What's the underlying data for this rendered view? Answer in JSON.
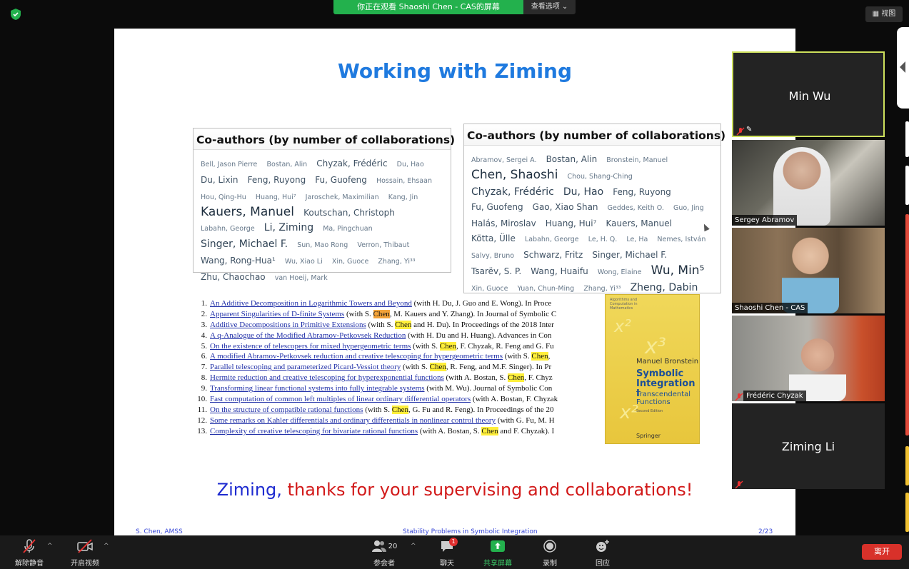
{
  "top_bar": {
    "share_banner": "你正在观看 Shaoshi Chen - CAS的屏幕",
    "view_options": "查看选项",
    "view_button": "视图",
    "accent_green": "#23b14d"
  },
  "slide": {
    "title": "Working with Ziming",
    "coauthors_left": {
      "header": "Co-authors (by number of collaborations)",
      "names": [
        {
          "t": "Bell, Jason Pierre",
          "w": 1
        },
        {
          "t": "Bostan, Alin",
          "w": 1
        },
        {
          "t": "Chyzak, Frédéric",
          "w": 2
        },
        {
          "t": "Du, Hao",
          "w": 1
        },
        {
          "t": "Du, Lixin",
          "w": 2
        },
        {
          "t": "Feng, Ruyong",
          "w": 2
        },
        {
          "t": "Fu, Guofeng",
          "w": 2
        },
        {
          "t": "Hossain, Ehsaan",
          "w": 1
        },
        {
          "t": "Hou, Qing-Hu",
          "w": 1
        },
        {
          "t": "Huang, Hui⁷",
          "w": 1
        },
        {
          "t": "Jaroschek, Maximilian",
          "w": 1
        },
        {
          "t": "Kang, Jin",
          "w": 1
        },
        {
          "t": "Kauers, Manuel",
          "w": 4
        },
        {
          "t": "Koutschan, Christoph",
          "w": 2
        },
        {
          "t": "Labahn, George",
          "w": 1
        },
        {
          "t": "Li, Ziming",
          "w": 3
        },
        {
          "t": "Ma, Pingchuan",
          "w": 1
        },
        {
          "t": "Singer, Michael F.",
          "w": 3
        },
        {
          "t": "Sun, Mao Rong",
          "w": 1
        },
        {
          "t": "Verron, Thibaut",
          "w": 1
        },
        {
          "t": "Wang, Rong-Hua¹",
          "w": 2
        },
        {
          "t": "Wu, Xiao Li",
          "w": 1
        },
        {
          "t": "Xin, Guoce",
          "w": 1
        },
        {
          "t": "Zhang, Yi³³",
          "w": 1
        },
        {
          "t": "Zhu, Chaochao",
          "w": 2
        },
        {
          "t": "van Hoeij, Mark",
          "w": 1
        }
      ]
    },
    "coauthors_right": {
      "header": "Co-authors (by number of collaborations)",
      "names": [
        {
          "t": "Abramov, Sergei A.",
          "w": 1
        },
        {
          "t": "Bostan, Alin",
          "w": 2
        },
        {
          "t": "Bronstein, Manuel",
          "w": 1
        },
        {
          "t": "Chen, Shaoshi",
          "w": 4
        },
        {
          "t": "Chou, Shang-Ching",
          "w": 1
        },
        {
          "t": "Chyzak, Frédéric",
          "w": 3
        },
        {
          "t": "Du, Hao",
          "w": 3
        },
        {
          "t": "Feng, Ruyong",
          "w": 2
        },
        {
          "t": "Fu, Guofeng",
          "w": 2
        },
        {
          "t": "Gao, Xiao Shan",
          "w": 2
        },
        {
          "t": "Geddes, Keith O.",
          "w": 1
        },
        {
          "t": "Guo, Jing",
          "w": 1
        },
        {
          "t": "Halás, Miroslav",
          "w": 2
        },
        {
          "t": "Huang, Hui⁷",
          "w": 2
        },
        {
          "t": "Kauers, Manuel",
          "w": 2
        },
        {
          "t": "Kötta, Ülle",
          "w": 2
        },
        {
          "t": "Labahn, George",
          "w": 1
        },
        {
          "t": "Le, H. Q.",
          "w": 1
        },
        {
          "t": "Le, Ha",
          "w": 1
        },
        {
          "t": "Nemes, István",
          "w": 1
        },
        {
          "t": "Salvy, Bruno",
          "w": 1
        },
        {
          "t": "Schwarz, Fritz",
          "w": 2
        },
        {
          "t": "Singer, Michael F.",
          "w": 2
        },
        {
          "t": "Tsarëv, S. P.",
          "w": 2
        },
        {
          "t": "Wang, Huaifu",
          "w": 2
        },
        {
          "t": "Wong, Elaine",
          "w": 1
        },
        {
          "t": "Wu, Min⁵",
          "w": 4
        },
        {
          "t": "Xin, Guoce",
          "w": 1
        },
        {
          "t": "Yuan, Chun-Ming",
          "w": 1
        },
        {
          "t": "Zhang, Yi³³",
          "w": 1
        },
        {
          "t": "Zheng, Dabin",
          "w": 3
        }
      ]
    },
    "papers": [
      {
        "n": "1.",
        "title": "An Additive Decomposition in Logarithmic Towers and Beyond",
        "rest": " (with H. Du, J. Guo and E. Wong). In Proce"
      },
      {
        "n": "2.",
        "title": "Apparent Singularities of D-finite Systems",
        "pre": " (with S. ",
        "hl": "Chen",
        "post": ", M. Kauers and Y. Zhang). In Journal of Symbolic C",
        "orange": true
      },
      {
        "n": "3.",
        "title": "Additive Decompositions in Primitive Extensions",
        "pre": " (with S. ",
        "hl": "Chen",
        "post": " and H. Du). In Proceedings of the 2018 Inter"
      },
      {
        "n": "4.",
        "title": "A q-Analogue of the Modified Abramov-Petkovsek Reduction",
        "rest": " (with H. Du and H. Huang). Advances in Con"
      },
      {
        "n": "5.",
        "title": "On the existence of telescopers for mixed hypergeometric terms",
        "pre": " (with S. ",
        "hl": "Chen",
        "post": ", F. Chyzak, R. Feng and G. Fu"
      },
      {
        "n": "6.",
        "title": "A modified Abramov-Petkovsek reduction and creative telescoping for hypergeometric terms",
        "pre": " (with S. ",
        "hl": "Chen",
        "post": ", "
      },
      {
        "n": "7.",
        "title": "Parallel telescoping and parameterized Picard-Vessiot theory",
        "pre": " (with S. ",
        "hl": "Chen",
        "post": ", R. Feng, and M.F. Singer). In Pr"
      },
      {
        "n": "8.",
        "title": "Hermite reduction and creative telescoping for hyperexponential functions",
        "pre": " (with A. Bostan, S. ",
        "hl": "Chen",
        "post": ", F. Chyz"
      },
      {
        "n": "9.",
        "title": "Transforming linear functional systems into fully integrable systems",
        "rest": " (with M. Wu). Journal of Symbolic Con"
      },
      {
        "n": "10.",
        "title": "Fast computation of common left multiples of linear ordinary differential operators",
        "rest": " (with A. Bostan, F. Chyzak"
      },
      {
        "n": "11.",
        "title": "On the structure of compatible rational functions",
        "pre": " (with S. ",
        "hl": "Chen",
        "post": ", G. Fu and R. Feng). In Proceedings of the 20"
      },
      {
        "n": "12.",
        "title": "Some remarks on Kahler differentials and ordinary differentials in nonlinear control theory",
        "rest": " (with G. Fu, M. H"
      },
      {
        "n": "13.",
        "title": "Complexity of creative telescoping for bivariate rational functions",
        "pre": " (with A. Bostan, S. ",
        "hl": "Chen",
        "post": " and F. Chyzak). I"
      }
    ],
    "book": {
      "series": "Algorithms and Computation in Mathematics",
      "author": "Manuel Bronstein",
      "title_line1": "Symbolic",
      "title_line2": "Integration I",
      "subtitle_line1": "Transcendental",
      "subtitle_line2": "Functions",
      "edition": "Second Edition",
      "publisher": "Springer"
    },
    "thanks_name": "Ziming,",
    "thanks_rest": " thanks for your supervising and collaborations!",
    "footer_left": "S. Chen, AMSS",
    "footer_center": "Stability Problems in Symbolic Integration",
    "footer_right": "2/23",
    "title_color": "#1f7adf",
    "thanks_color": "#d21a1a",
    "highlight_color": "#ffef3a"
  },
  "participants": [
    {
      "name": "Min Wu",
      "mode": "name-only"
    },
    {
      "name": "Sergey Abramov",
      "mode": "video"
    },
    {
      "name": "Shaoshi Chen - CAS",
      "mode": "video"
    },
    {
      "name": "Frédéric Chyzak",
      "mode": "video",
      "muted": true
    },
    {
      "name": "Ziming Li",
      "mode": "name-only",
      "muted": true
    }
  ],
  "toolbar": {
    "unmute": "解除静音",
    "start_video": "开启视频",
    "participants": "参会者",
    "participant_count": "20",
    "chat": "聊天",
    "chat_badge": "1",
    "share_screen": "共享屏幕",
    "record": "录制",
    "reactions": "回应",
    "leave": "离开",
    "leave_color": "#d8312a"
  }
}
